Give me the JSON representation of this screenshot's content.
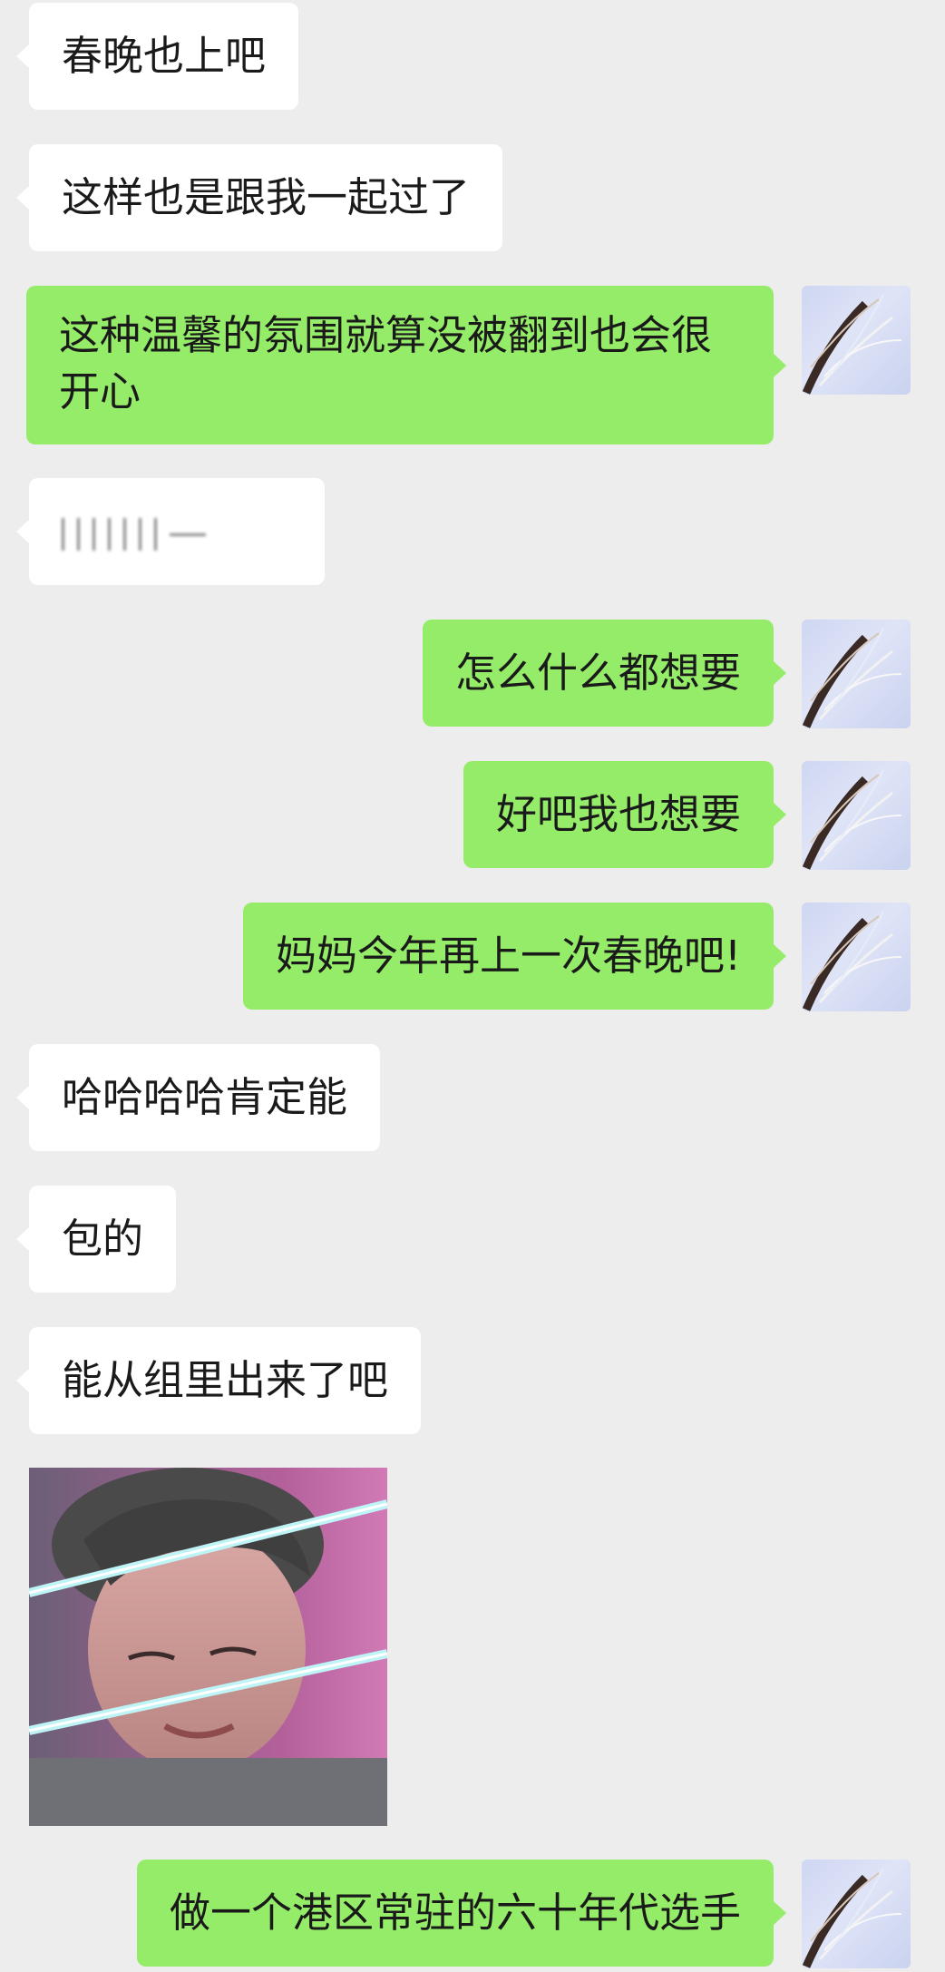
{
  "messages": [
    {
      "side": "left",
      "text": "春晚也上吧"
    },
    {
      "side": "left",
      "text": "这样也是跟我一起过了"
    },
    {
      "side": "right",
      "text": "这种温馨的氛围就算没被翻到也会很开心"
    },
    {
      "side": "left",
      "text": "",
      "content": "blurred-handwriting"
    },
    {
      "side": "right",
      "text": "怎么什么都想要"
    },
    {
      "side": "right",
      "text": "好吧我也想要"
    },
    {
      "side": "right",
      "text": "妈妈今年再上一次春晚吧!"
    },
    {
      "side": "left",
      "text": "哈哈哈哈肯定能"
    },
    {
      "side": "left",
      "text": "包的"
    },
    {
      "side": "left",
      "text": "能从组里出来了吧"
    },
    {
      "side": "left",
      "content": "photo"
    },
    {
      "side": "right",
      "text": "做一个港区常驻的六十年代选手"
    }
  ],
  "colors": {
    "background": "#ededed",
    "incoming_bubble": "#ffffff",
    "outgoing_bubble": "#95ec69",
    "text": "#1a1a1a"
  },
  "icons": {
    "avatar": "user-avatar-icon"
  }
}
